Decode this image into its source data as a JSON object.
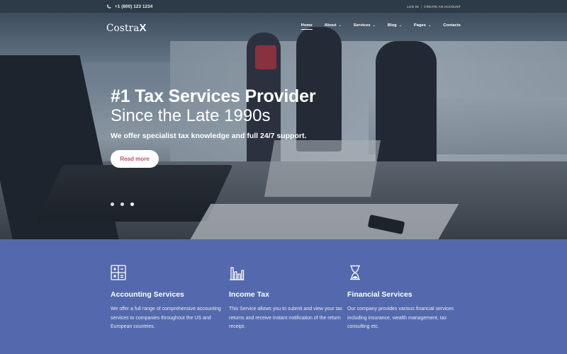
{
  "topbar": {
    "phone": "+1 (800) 123 1234",
    "login": "LOG IN",
    "separator": "|",
    "create_account": "CREATE AN ACCOUNT"
  },
  "brand": {
    "name": "Costra",
    "mark": "X"
  },
  "nav": [
    {
      "label": "Home",
      "active": true,
      "dropdown": false
    },
    {
      "label": "About",
      "dropdown": true
    },
    {
      "label": "Services",
      "dropdown": true
    },
    {
      "label": "Blog",
      "dropdown": true
    },
    {
      "label": "Pages",
      "dropdown": true
    },
    {
      "label": "Contacts",
      "dropdown": false
    }
  ],
  "hero": {
    "title": "#1 Tax Services Provider",
    "subtitle": "Since the Late 1990s",
    "description": "We offer specialist tax knowledge and full 24/7 support.",
    "button": "Read more",
    "slides": {
      "count": 3,
      "active_index": 2
    }
  },
  "services": [
    {
      "icon": "calculator-icon",
      "title": "Accounting Services",
      "text": "We offer a full range of comprehensive accounting services to companies throughout the US and European countries."
    },
    {
      "icon": "bar-chart-icon",
      "title": "Income Tax",
      "text": "This Service allows you to submit and view your tax returns and receive instant notification of the return receipt."
    },
    {
      "icon": "hourglass-icon",
      "title": "Financial Services",
      "text": "Our company provides various financial services including insurance, wealth management, tax consulting etc."
    }
  ],
  "colors": {
    "topbar": "#2d3a47",
    "services_bg": "#5469ad",
    "button_text": "#c0506d"
  }
}
